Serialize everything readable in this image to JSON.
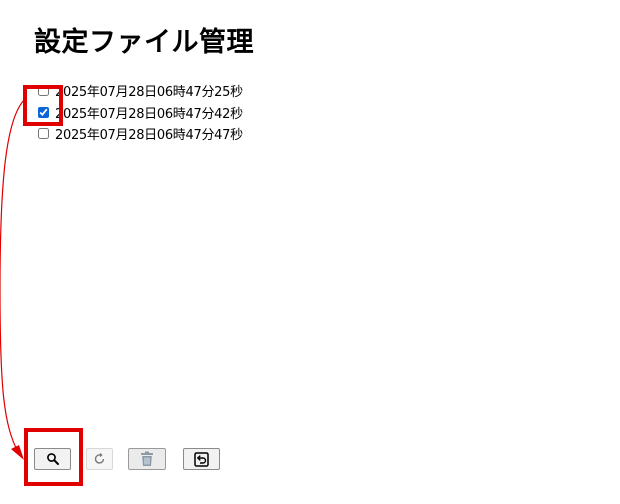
{
  "page": {
    "title": "設定ファイル管理"
  },
  "files": [
    {
      "label": "2025年07月28日06時47分25秒",
      "checked": false
    },
    {
      "label": "2025年07月28日06時47分42秒",
      "checked": true
    },
    {
      "label": "2025年07月28日06時47分47秒",
      "checked": false
    }
  ],
  "toolbar": {
    "buttons": [
      {
        "name": "search-button",
        "icon": "search-icon"
      },
      {
        "name": "restore-button",
        "icon": "refresh-icon"
      },
      {
        "name": "delete-button",
        "icon": "trash-icon"
      },
      {
        "name": "back-button",
        "icon": "return-icon"
      }
    ]
  },
  "annotation": {
    "color": "#e00000"
  }
}
